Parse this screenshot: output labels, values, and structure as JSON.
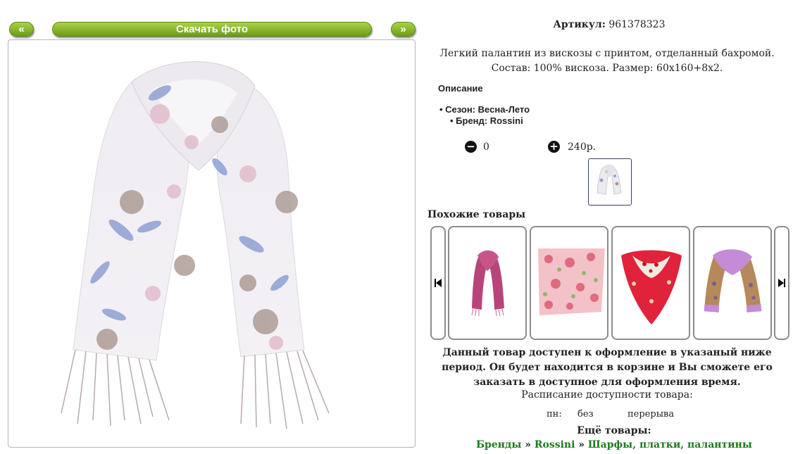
{
  "viewer": {
    "prev_label": "«",
    "download_label": "Скачать фото",
    "next_label": "»"
  },
  "product": {
    "article_label": "Артикул:",
    "article_value": "961378323",
    "description": "Легкий палантин из вискозы с принтом, отделанный бахромой. Состав: 100% вискоза. Размер: 60x160+8x2.",
    "section_title": "Описание",
    "specs": [
      "Сезон: Весна-Лето",
      "Бренд: Rossini"
    ],
    "quantity": "0",
    "price": "240р."
  },
  "similar": {
    "title": "Похожие товары",
    "items": [
      "pink-scarf",
      "floral-square-scarf",
      "red-paisley-shawl",
      "lilac-paisley-scarf"
    ]
  },
  "availability": {
    "notice": "Данный товар доступен к оформление в указаный ниже период. Он будет находится в корзине и Вы сможете его заказать в доступное для оформления время.",
    "schedule_title": "Расписание доступности товара:",
    "day": "пн:",
    "from": "без",
    "to": "перерыва"
  },
  "more": {
    "title": "Ещё товары:",
    "crumb_brands": "Бренды",
    "crumb_sep": "»",
    "crumb_brand": "Rossini",
    "crumb_category": "Шарфы, платки, палантины"
  },
  "colors": {
    "accent_green": "#7fb226",
    "link_green": "#1d7a1d",
    "frame_border": "#b5b5b5"
  }
}
